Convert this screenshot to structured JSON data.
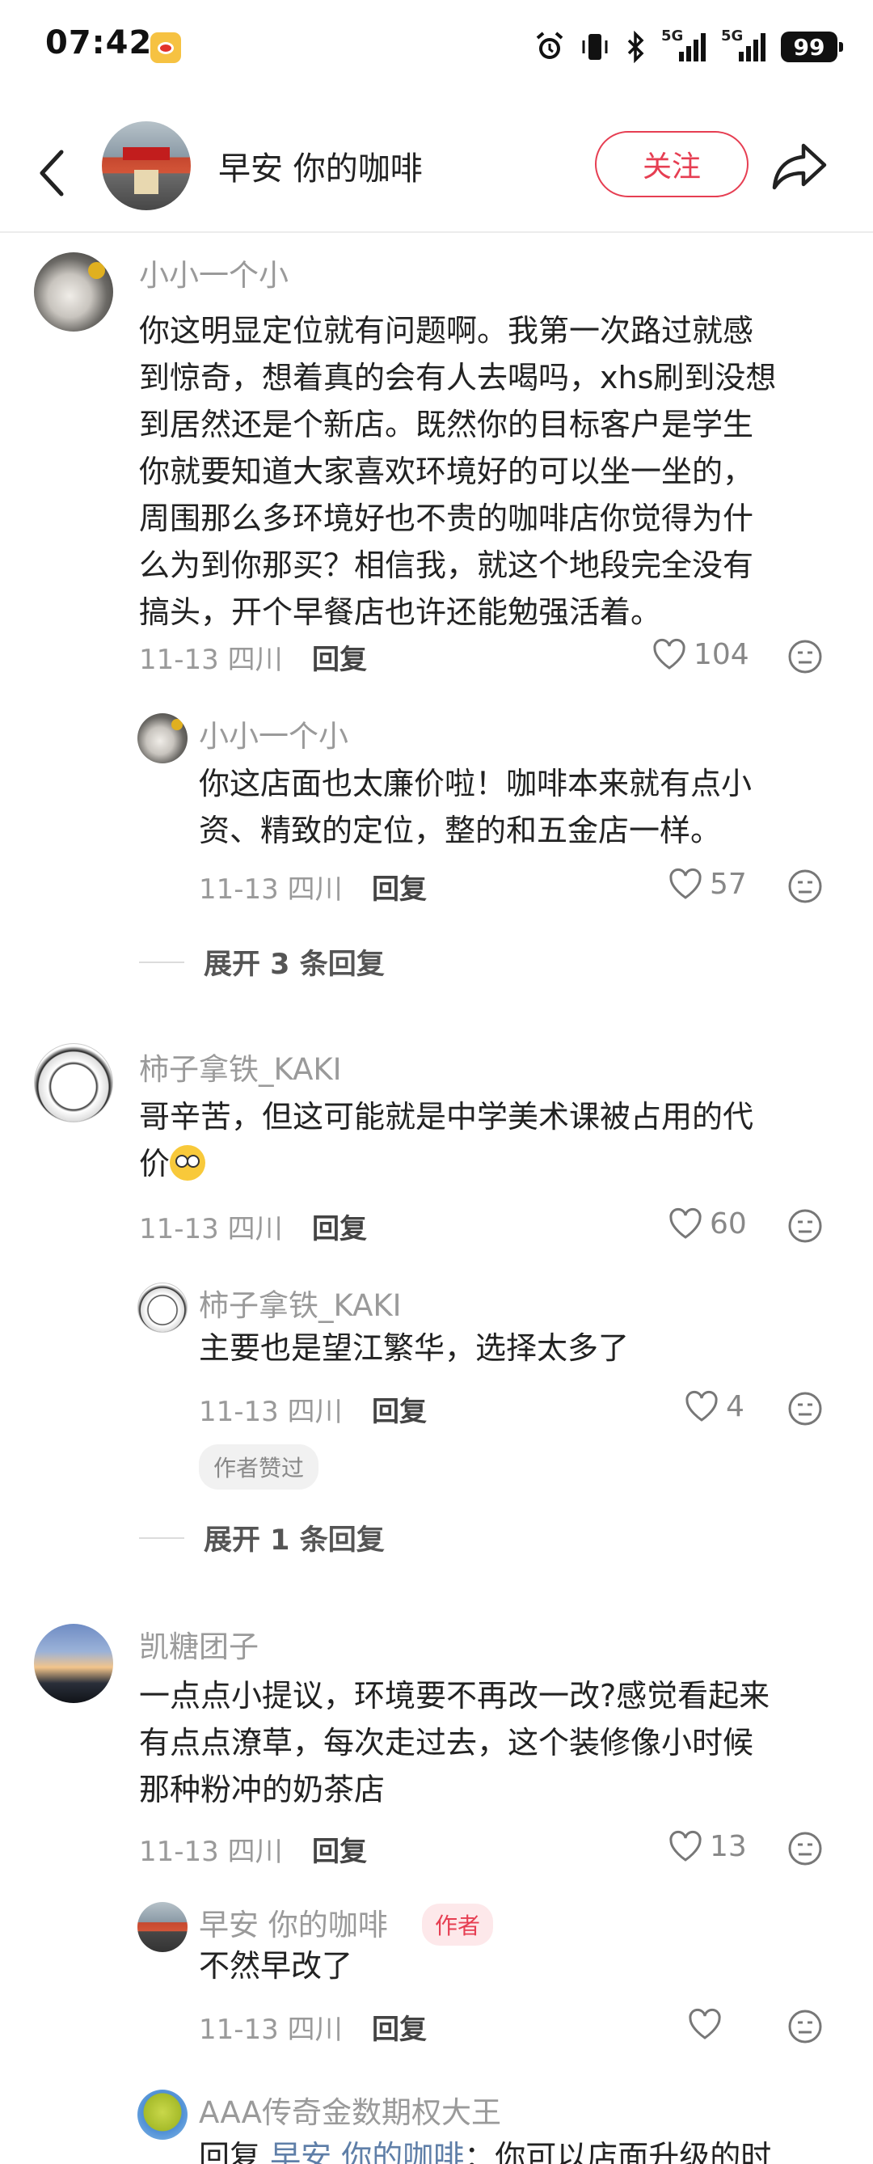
{
  "status_bar": {
    "time": "07:42",
    "battery": "99",
    "signal1": "5G",
    "signal2": "5G"
  },
  "header": {
    "title": "早安 你的咖啡",
    "follow_label": "关注"
  },
  "comments": [
    {
      "name": "小小一个小",
      "lines": [
        "你这明显定位就有问题啊。我第一次路过就感",
        "到惊奇，想着真的会有人去喝吗，xhs刷到没想",
        "到居然还是个新店。既然你的目标客户是学生",
        "你就要知道大家喜欢环境好的可以坐一坐的，",
        "周围那么多环境好也不贵的咖啡店你觉得为什",
        "么为到你那买？相信我，就这个地段完全没有",
        "搞头，开个早餐店也许还能勉强活着。"
      ],
      "meta": "11-13 四川",
      "reply_label": "回复",
      "likes": "104"
    },
    {
      "name": "小小一个小",
      "lines": [
        "你这店面也太廉价啦！咖啡本来就有点小",
        "资、精致的定位，整的和五金店一样。"
      ],
      "meta": "11-13 四川",
      "reply_label": "回复",
      "likes": "57"
    },
    {
      "name": "柿子拿铁_KAKI",
      "lines": [
        "哥辛苦，但这可能就是中学美术课被占用的代",
        "价"
      ],
      "meta": "11-13 四川",
      "reply_label": "回复",
      "likes": "60"
    },
    {
      "name": "柿子拿铁_KAKI",
      "lines": [
        "主要也是望江繁华，选择太多了"
      ],
      "meta": "11-13 四川",
      "reply_label": "回复",
      "likes": "4",
      "badge": "作者赞过"
    },
    {
      "name": "凯糖团子",
      "lines": [
        "一点点小提议，环境要不再改一改?感觉看起来",
        "有点点潦草，每次走过去，这个装修像小时候",
        "那种粉冲的奶茶店"
      ],
      "meta": "11-13 四川",
      "reply_label": "回复",
      "likes": "13"
    },
    {
      "name": "早安 你的咖啡",
      "author_badge": "作者",
      "lines": [
        "不然早改了"
      ],
      "meta": "11-13 四川",
      "reply_label": "回复",
      "likes": ""
    },
    {
      "name": "AAA传奇金数期权大王",
      "line_prefix": "回复",
      "line_mention": "早安 你的咖啡",
      "line_rest": "：你可以店面升级的时"
    }
  ],
  "expand": [
    "展开 3 条回复",
    "展开 1 条回复"
  ]
}
